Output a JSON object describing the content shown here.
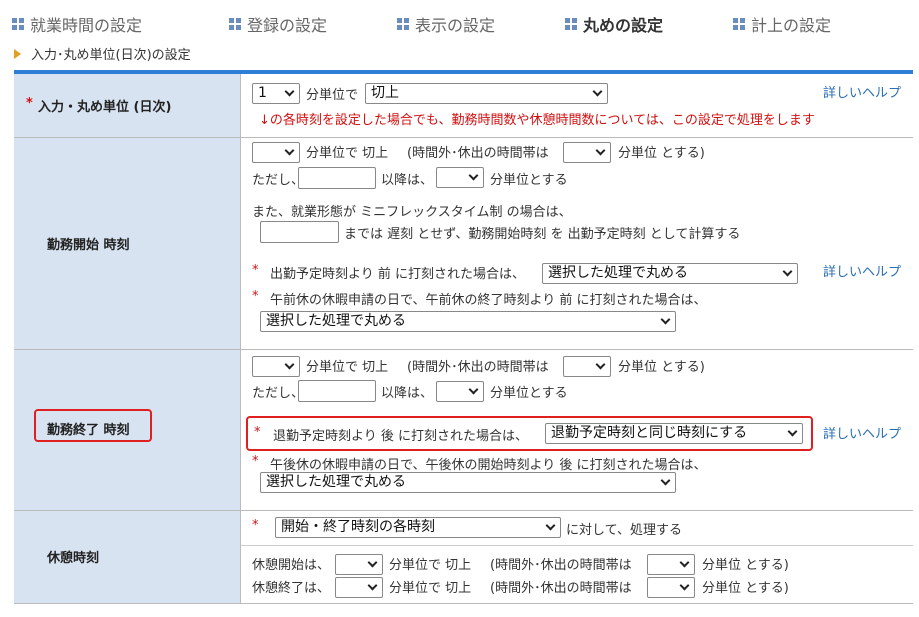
{
  "tabs": [
    {
      "label": "就業時間の設定"
    },
    {
      "label": "登録の設定"
    },
    {
      "label": "表示の設定"
    },
    {
      "label": "丸めの設定"
    },
    {
      "label": "計上の設定"
    }
  ],
  "breadcrumb": "入力･丸め単位(日次)の設定",
  "help_label": "詳しいヘルプ",
  "input_unit": {
    "label": "入力・丸め単位 (日次)",
    "required_mark": "*",
    "unit_value": "1",
    "unit_suffix": "分単位で",
    "method_value": "切上",
    "warning": "↓の各時刻を設定した場合でも、勤務時間数や休憩時間数については、この設定で処理をします"
  },
  "start": {
    "label": "勤務開始 時刻",
    "line1_a": "分単位で 切上",
    "line1_b": "(時間外･休出の時間帯は",
    "line1_c": "分単位 とする)",
    "line2_a": "ただし、",
    "line2_b": "以降は、",
    "line2_c": "分単位とする",
    "line3": "また、就業形態が ミニフレックスタイム制 の場合は、",
    "line4": "までは 遅刻 とせず、勤務開始時刻 を 出勤予定時刻 として計算する",
    "cond1": "出勤予定時刻より 前 に打刻された場合は、",
    "cond1_value": "選択した処理で丸める",
    "cond2": "午前休の休暇申請の日で、午前休の終了時刻より 前 に打刻された場合は、",
    "cond2_value": "選択した処理で丸める"
  },
  "end": {
    "label": "勤務終了 時刻",
    "line1_a": "分単位で 切上",
    "line1_b": "(時間外･休出の時間帯は",
    "line1_c": "分単位 とする)",
    "line2_a": "ただし、",
    "line2_b": "以降は、",
    "line2_c": "分単位とする",
    "cond1": "退勤予定時刻より 後 に打刻された場合は、",
    "cond1_value": "退勤予定時刻と同じ時刻にする",
    "cond2": "午後休の休暇申請の日で、午後休の開始時刻より 後 に打刻された場合は、",
    "cond2_value": "選択した処理で丸める"
  },
  "break": {
    "label": "休憩時刻",
    "select_value": "開始・終了時刻の各時刻",
    "select_suffix": "に対して、処理する",
    "start_a": "休憩開始は、",
    "end_a": "休憩終了は、",
    "unit_a": "分単位で 切上",
    "unit_b": "(時間外･休出の時間帯は",
    "unit_c": "分単位 とする)"
  },
  "colors": {
    "accent": "#2c7ed6",
    "label_bg": "#d8e3f1",
    "warning": "#d01010",
    "highlight": "#e02020"
  }
}
